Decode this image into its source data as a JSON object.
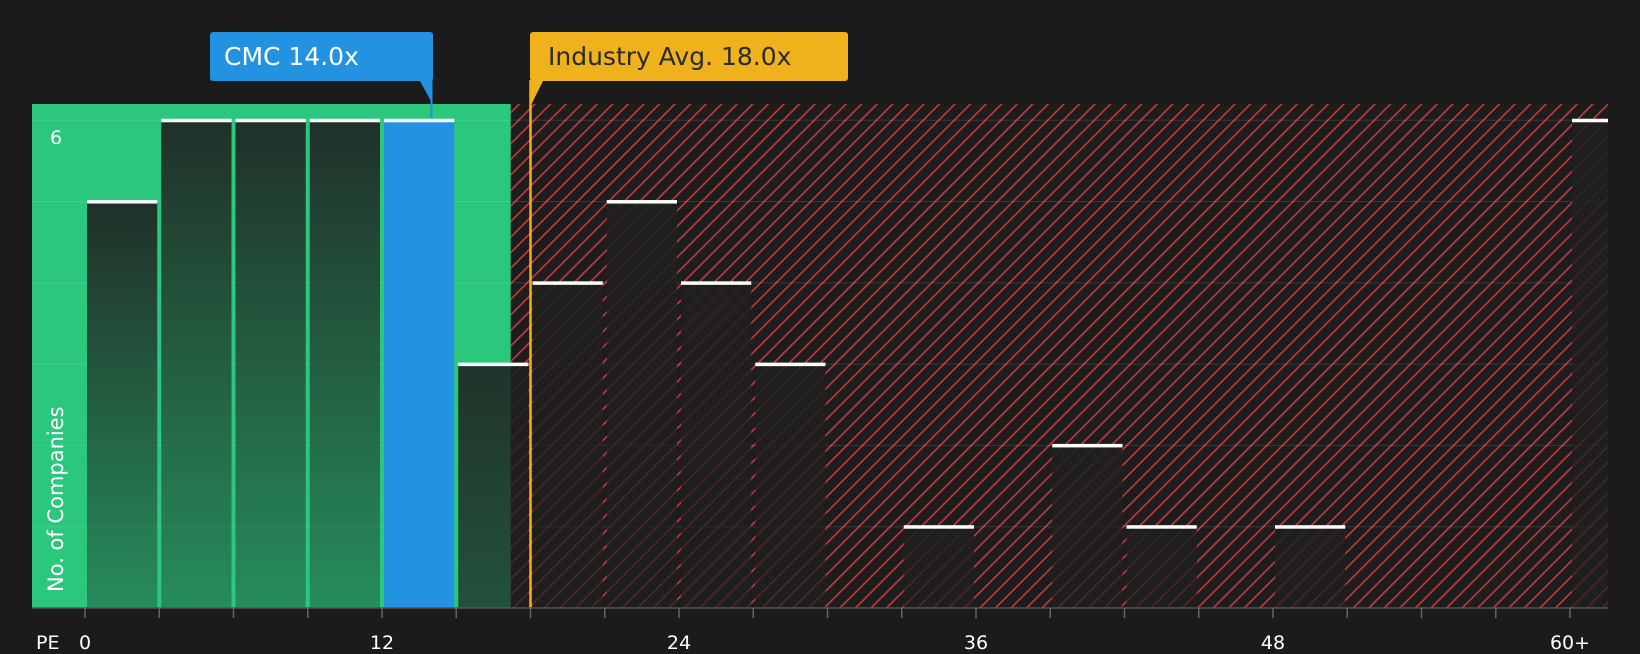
{
  "chart_data": {
    "type": "bar",
    "x_label": "PE",
    "y_label": "No. of Companies",
    "y_tick_label": "6",
    "ylim": [
      0,
      6.2
    ],
    "x_ticks": [
      {
        "value": 0,
        "label": "0"
      },
      {
        "value": 12,
        "label": "12"
      },
      {
        "value": 24,
        "label": "24"
      },
      {
        "value": 36,
        "label": "36"
      },
      {
        "value": 48,
        "label": "48"
      },
      {
        "value": 60,
        "label": "60+"
      }
    ],
    "bins": [
      {
        "start": 0,
        "end": 3,
        "count": 5
      },
      {
        "start": 3,
        "end": 6,
        "count": 6
      },
      {
        "start": 6,
        "end": 9,
        "count": 6
      },
      {
        "start": 9,
        "end": 12,
        "count": 6
      },
      {
        "start": 12,
        "end": 15,
        "count": 6,
        "highlight": true
      },
      {
        "start": 15,
        "end": 18,
        "count": 3
      },
      {
        "start": 18,
        "end": 21,
        "count": 4
      },
      {
        "start": 21,
        "end": 24,
        "count": 5
      },
      {
        "start": 24,
        "end": 27,
        "count": 4
      },
      {
        "start": 27,
        "end": 30,
        "count": 3
      },
      {
        "start": 30,
        "end": 33,
        "count": 0
      },
      {
        "start": 33,
        "end": 36,
        "count": 1
      },
      {
        "start": 36,
        "end": 39,
        "count": 0
      },
      {
        "start": 39,
        "end": 42,
        "count": 2
      },
      {
        "start": 42,
        "end": 45,
        "count": 1
      },
      {
        "start": 45,
        "end": 48,
        "count": 0
      },
      {
        "start": 48,
        "end": 51,
        "count": 1
      },
      {
        "start": 51,
        "end": 54,
        "count": 0
      },
      {
        "start": 54,
        "end": 57,
        "count": 0
      },
      {
        "start": 57,
        "end": 60,
        "count": 0
      },
      {
        "start": 60,
        "end": 63,
        "count": 6
      }
    ],
    "company": {
      "label": "CMC 14.0x",
      "value": 14.0
    },
    "industry": {
      "label": "Industry Avg. 18.0x",
      "value": 18.0
    },
    "good_zone_max": 17.2,
    "colors": {
      "background": "#1b1b1b",
      "good_zone": "#2ac77c",
      "bad_hatch": "#c73a3a",
      "company": "#2392e0",
      "industry": "#efb21d",
      "bar_dark": "#1f1f1f",
      "bar_cap": "#ffffff"
    }
  }
}
